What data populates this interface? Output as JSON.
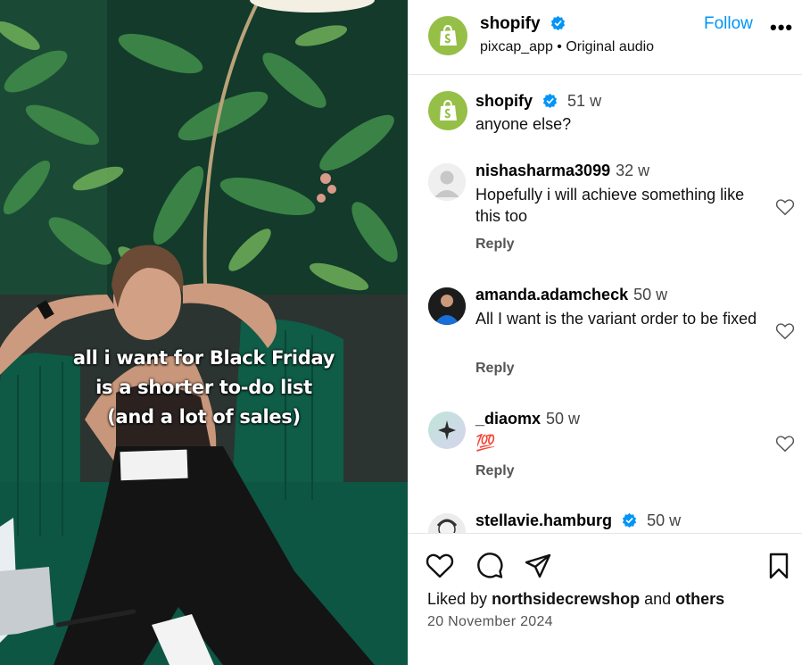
{
  "media": {
    "caption_lines": [
      "all i want for Black Friday",
      "is a shorter to-do list",
      "(and a lot of sales)"
    ]
  },
  "header": {
    "username": "shopify",
    "verified": true,
    "subtitle": "pixcap_app • Original audio",
    "follow_label": "Follow",
    "more_label": "•••"
  },
  "caption_comment": {
    "username": "shopify",
    "time": "51 w",
    "text": "anyone else?"
  },
  "comments": [
    {
      "username": "nishasharma3099",
      "time": "32 w",
      "text": "Hopefully i will achieve something like this too",
      "reply": "Reply"
    },
    {
      "username": "amanda.adamcheck",
      "time": "50 w",
      "text": "All I want is the variant order to be fixed",
      "reply": "Reply"
    },
    {
      "username": "_diaomx",
      "time": "50 w",
      "text": "💯",
      "reply": "Reply"
    },
    {
      "username": "stellavie.hamburg",
      "time": "50 w",
      "verified": true
    }
  ],
  "footer": {
    "liked_prefix": "Liked by",
    "liked_user": "northsidecrewshop",
    "liked_and": "and",
    "liked_others": "others",
    "date": "20 November 2024"
  },
  "colors": {
    "accent": "#0095f6",
    "shopify_green": "#95bf47",
    "verified_blue": "#0095f6"
  },
  "icons": [
    "heart-icon",
    "comment-icon",
    "share-icon",
    "bookmark-icon",
    "verified-icon",
    "more-icon"
  ]
}
